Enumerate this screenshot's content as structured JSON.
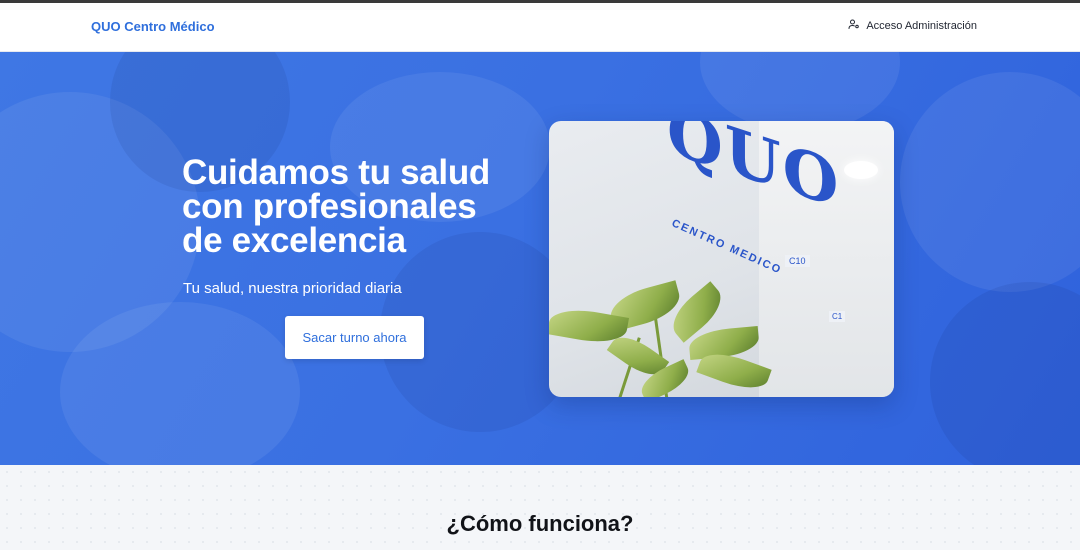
{
  "navbar": {
    "brand": "QUO Centro Médico",
    "admin_link": "Acceso Administración",
    "admin_icon": "user-cog-icon"
  },
  "hero": {
    "headline": "Cuidamos tu salud con profesionales de excelencia",
    "subtitle": "Tu salud, nuestra prioridad diaria",
    "cta_label": "Sacar turno ahora",
    "photo": {
      "sign_text": "QUO",
      "sign_subtext": "CENTRO MEDICO",
      "room_tag": "C10",
      "room_tag_2": "C1"
    }
  },
  "how_it_works": {
    "title": "¿Cómo funciona?"
  },
  "colors": {
    "brand": "#2f6fdc",
    "hero_bg": "#3a70e2",
    "text_dark": "#111318"
  }
}
